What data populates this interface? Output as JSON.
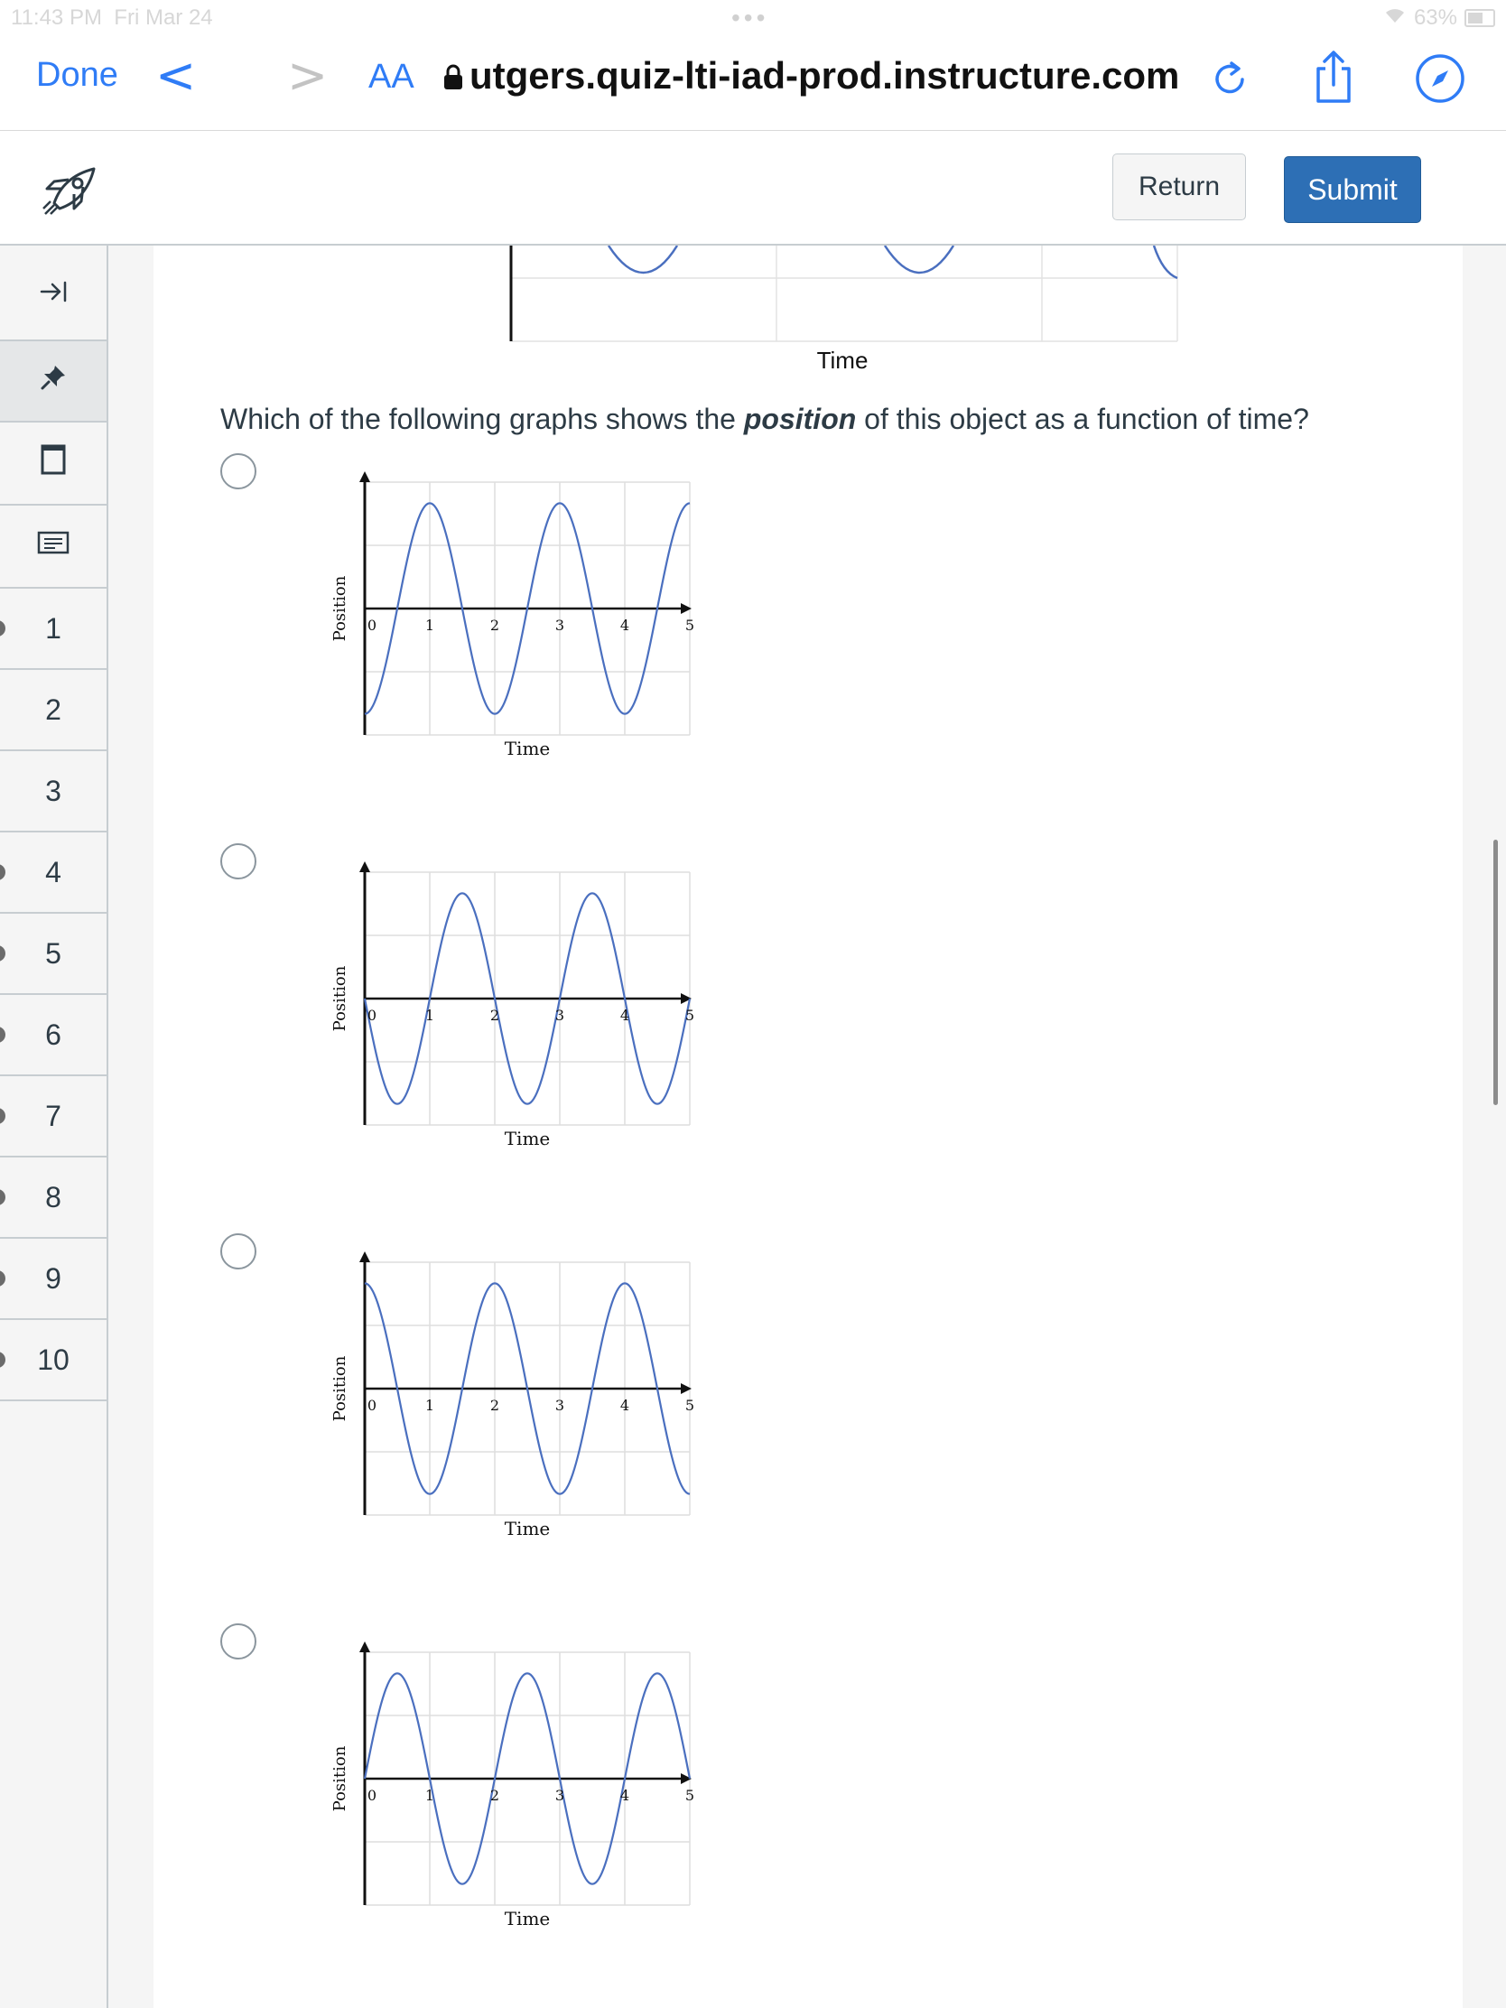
{
  "status_bar": {
    "time": "11:43 PM",
    "date": "Fri Mar 24",
    "battery": "63%"
  },
  "browser": {
    "done_label": "Done",
    "text_size_label": "AA",
    "url": "utgers.quiz-lti-iad-prod.instructure.com"
  },
  "quiz_header": {
    "return_label": "Return",
    "submit_label": "Submit"
  },
  "sidebar": {
    "questions": [
      "1",
      "2",
      "3",
      "4",
      "5",
      "6",
      "7",
      "8",
      "9",
      "10"
    ]
  },
  "question": {
    "prompt_before": "Which of the following graphs shows the ",
    "prompt_emphasis": "position",
    "prompt_after": " of this object as a function of time?",
    "previous_graph_xlabel": "Time"
  },
  "chart_data": [
    {
      "type": "line",
      "ylabel": "Position",
      "xlabel": "Time",
      "x_ticks": [
        "0",
        "1",
        "2",
        "3",
        "4",
        "5"
      ],
      "xlim": [
        0,
        5
      ],
      "ylim": [
        -1.2,
        1.2
      ],
      "series": [
        {
          "function": "-cos(pi*t)",
          "amplitude": 1,
          "period": 2,
          "x": [
            0,
            1,
            2,
            3,
            4,
            5
          ],
          "y": [
            -1,
            1,
            -1,
            1,
            -1,
            1
          ]
        }
      ]
    },
    {
      "type": "line",
      "ylabel": "Position",
      "xlabel": "Time",
      "x_ticks": [
        "0",
        "1",
        "2",
        "3",
        "4",
        "5"
      ],
      "xlim": [
        0,
        5
      ],
      "ylim": [
        -1.2,
        1.2
      ],
      "series": [
        {
          "function": "-sin(pi*t)",
          "amplitude": 1,
          "period": 2,
          "x": [
            0,
            0.5,
            1,
            1.5,
            2,
            2.5,
            3,
            3.5,
            4,
            4.5,
            5
          ],
          "y": [
            0,
            -1,
            0,
            1,
            0,
            -1,
            0,
            1,
            0,
            -1,
            0
          ]
        }
      ]
    },
    {
      "type": "line",
      "ylabel": "Position",
      "xlabel": "Time",
      "x_ticks": [
        "0",
        "1",
        "2",
        "3",
        "4",
        "5"
      ],
      "xlim": [
        0,
        5
      ],
      "ylim": [
        -1.2,
        1.2
      ],
      "series": [
        {
          "function": "cos(pi*t)",
          "amplitude": 1,
          "period": 2,
          "x": [
            0,
            1,
            2,
            3,
            4,
            5
          ],
          "y": [
            1,
            -1,
            1,
            -1,
            1,
            -1
          ]
        }
      ]
    },
    {
      "type": "line",
      "ylabel": "Position",
      "xlabel": "Time",
      "x_ticks": [
        "0",
        "1",
        "2",
        "3",
        "4",
        "5"
      ],
      "xlim": [
        0,
        5
      ],
      "ylim": [
        -1.2,
        1.2
      ],
      "series": [
        {
          "function": "sin(pi*t)",
          "amplitude": 1,
          "period": 2,
          "x": [
            0,
            0.5,
            1,
            1.5,
            2,
            2.5,
            3,
            3.5,
            4,
            4.5,
            5
          ],
          "y": [
            0,
            1,
            0,
            -1,
            0,
            1,
            0,
            -1,
            0,
            1,
            0
          ]
        }
      ]
    }
  ]
}
